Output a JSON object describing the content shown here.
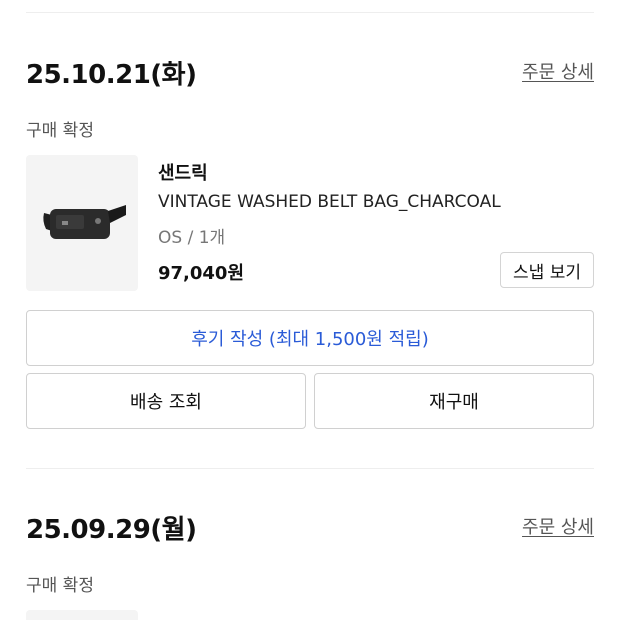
{
  "orders": [
    {
      "date": "25.10.21(화)",
      "detail_link": "주문 상세",
      "status": "구매 확정",
      "product": {
        "image_icon": "belt-bag-image",
        "brand": "샌드릭",
        "name": "VINTAGE WASHED BELT BAG_CHARCOAL",
        "option": "OS / 1개",
        "price": "97,040원"
      },
      "snap_label": "스냅 보기",
      "review_label": "후기 작성 (최대 1,500원 적립)",
      "shipping_label": "배송 조회",
      "rebuy_label": "재구매"
    },
    {
      "date": "25.09.29(월)",
      "detail_link": "주문 상세",
      "status": "구매 확정"
    }
  ],
  "colors": {
    "review_text": "#2a5bd7",
    "divider": "#eeeeee",
    "button_border": "#d0d0d0"
  }
}
